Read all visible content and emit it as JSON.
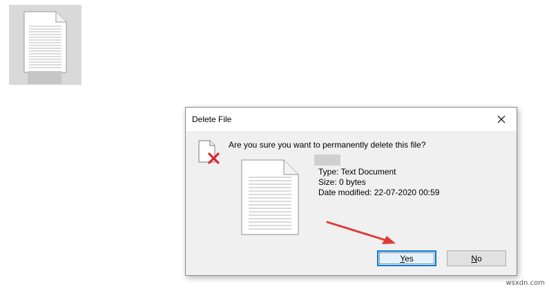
{
  "dialog": {
    "title": "Delete File",
    "question": "Are you sure you want to permanently delete this file?",
    "close_icon": "close-icon",
    "file_icon": "document-icon",
    "delete_icon": "document-delete-icon",
    "file": {
      "type": "Type: Text Document",
      "size": "Size: 0 bytes",
      "modified": "Date modified: 22-07-2020 00:59"
    },
    "buttons": {
      "yes_mnemonic": "Y",
      "yes_rest": "es",
      "no_mnemonic": "N",
      "no_rest": "o"
    }
  },
  "desktop": {
    "file_icon": "document-icon"
  },
  "annotation": {
    "arrow_color": "#e03a3a"
  },
  "watermark": "wsxdn.com",
  "colors": {
    "accent": "#0078d7",
    "delete_red": "#d9262c",
    "dialog_bg": "#f0f0f0"
  }
}
